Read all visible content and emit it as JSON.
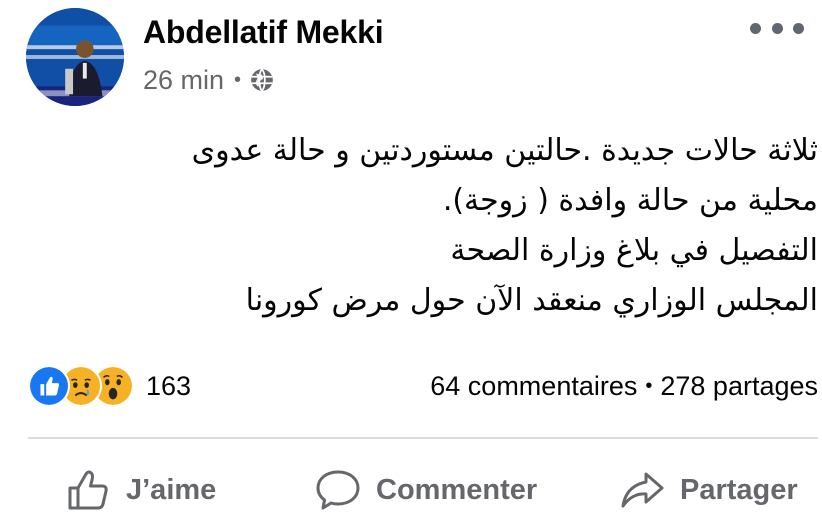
{
  "post": {
    "author": "Abdellatif Mekki",
    "time": "26 min",
    "separator": "•",
    "privacy_icon": "globe-icon",
    "more_icon": "more-options-icon",
    "body_lines": [
      "ثلاثة حالات جديدة .حالتين مستوردتين و حالة عدوى",
      "محلية من حالة وافدة ( زوجة).",
      "التفصيل في بلاغ وزارة الصحة",
      "المجلس الوزاري منعقد الآن حول مرض كورونا"
    ]
  },
  "reactions": {
    "icons": [
      "like-reaction-icon",
      "sad-reaction-icon",
      "wow-reaction-icon"
    ],
    "count": "163",
    "colors": {
      "like": "#1877f2",
      "emoji": "#f7b125"
    }
  },
  "engagement": {
    "comments": "64 commentaires",
    "separator": "•",
    "shares": "278 partages"
  },
  "actions": {
    "like_label": "J’aime",
    "comment_label": "Commenter",
    "share_label": "Partager"
  },
  "colors": {
    "text_primary": "#050505",
    "text_secondary": "#65676b",
    "divider": "#dadde1"
  }
}
